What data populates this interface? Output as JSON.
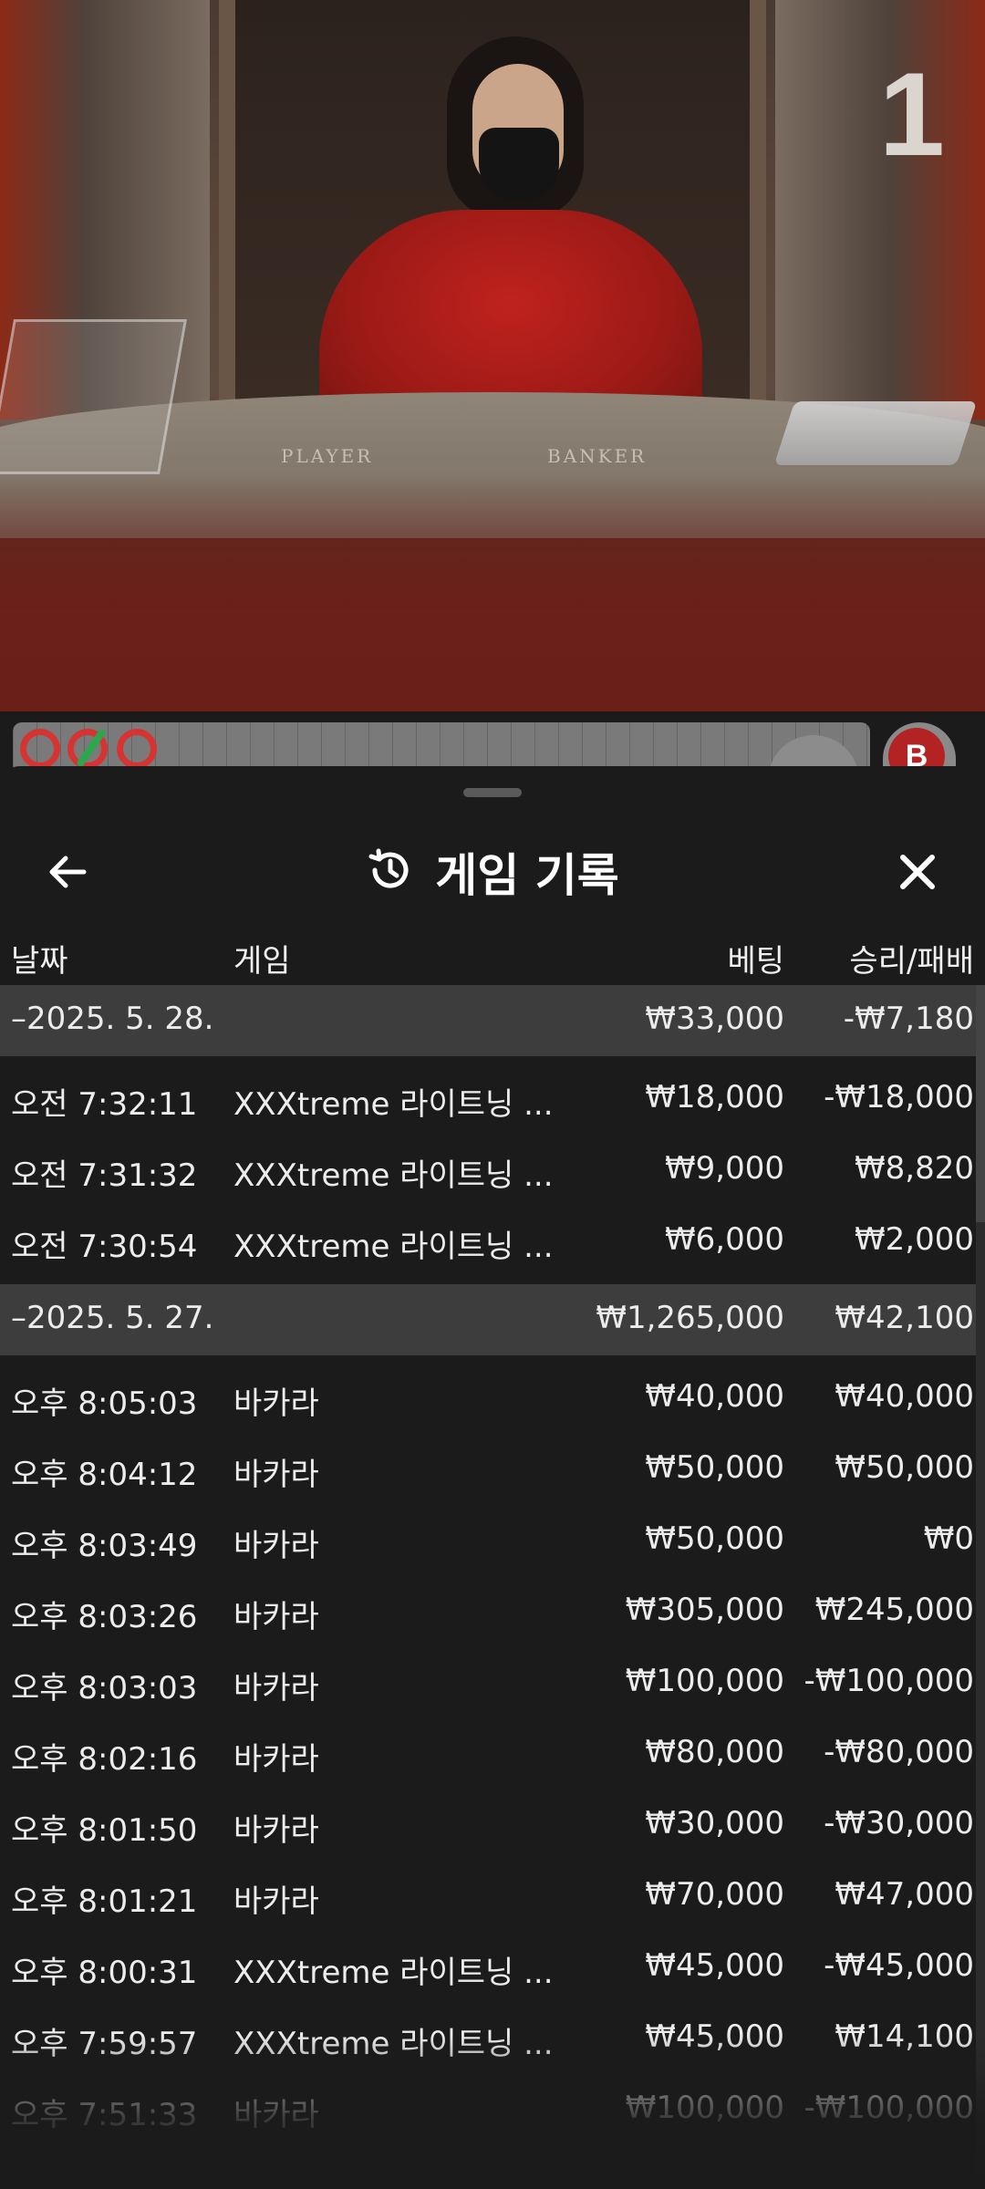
{
  "video": {
    "table_number": "1",
    "player_label": "PLAYER",
    "banker_label": "BANKER"
  },
  "road": {
    "badge": "B"
  },
  "header": {
    "title": "게임 기록",
    "back_icon": "arrow-left-icon",
    "history_icon": "history-icon",
    "close_icon": "close-icon"
  },
  "columns": {
    "date": "날짜",
    "game": "게임",
    "bet": "베팅",
    "result": "승리/패배"
  },
  "groups": [
    {
      "date": "–2025. 5. 28.",
      "bet_total": "₩33,000",
      "result_total": "-₩7,180",
      "rows": [
        {
          "time": "오전 7:32:11",
          "game": "XXXtreme 라이트닝 ...",
          "bet": "₩18,000",
          "result": "-₩18,000"
        },
        {
          "time": "오전 7:31:32",
          "game": "XXXtreme 라이트닝 ...",
          "bet": "₩9,000",
          "result": "₩8,820"
        },
        {
          "time": "오전 7:30:54",
          "game": "XXXtreme 라이트닝 ...",
          "bet": "₩6,000",
          "result": "₩2,000"
        }
      ]
    },
    {
      "date": "–2025. 5. 27.",
      "bet_total": "₩1,265,000",
      "result_total": "₩42,100",
      "rows": [
        {
          "time": "오후 8:05:03",
          "game": "바카라",
          "bet": "₩40,000",
          "result": "₩40,000"
        },
        {
          "time": "오후 8:04:12",
          "game": "바카라",
          "bet": "₩50,000",
          "result": "₩50,000"
        },
        {
          "time": "오후 8:03:49",
          "game": "바카라",
          "bet": "₩50,000",
          "result": "₩0"
        },
        {
          "time": "오후 8:03:26",
          "game": "바카라",
          "bet": "₩305,000",
          "result": "₩245,000"
        },
        {
          "time": "오후 8:03:03",
          "game": "바카라",
          "bet": "₩100,000",
          "result": "-₩100,000"
        },
        {
          "time": "오후 8:02:16",
          "game": "바카라",
          "bet": "₩80,000",
          "result": "-₩80,000"
        },
        {
          "time": "오후 8:01:50",
          "game": "바카라",
          "bet": "₩30,000",
          "result": "-₩30,000"
        },
        {
          "time": "오후 8:01:21",
          "game": "바카라",
          "bet": "₩70,000",
          "result": "₩47,000"
        },
        {
          "time": "오후 8:00:31",
          "game": "XXXtreme 라이트닝 ...",
          "bet": "₩45,000",
          "result": "-₩45,000"
        },
        {
          "time": "오후 7:59:57",
          "game": "XXXtreme 라이트닝 ...",
          "bet": "₩45,000",
          "result": "₩14,100"
        },
        {
          "time": "오후 7:51:33",
          "game": "바카라",
          "bet": "₩100,000",
          "result": "-₩100,000"
        }
      ]
    }
  ]
}
